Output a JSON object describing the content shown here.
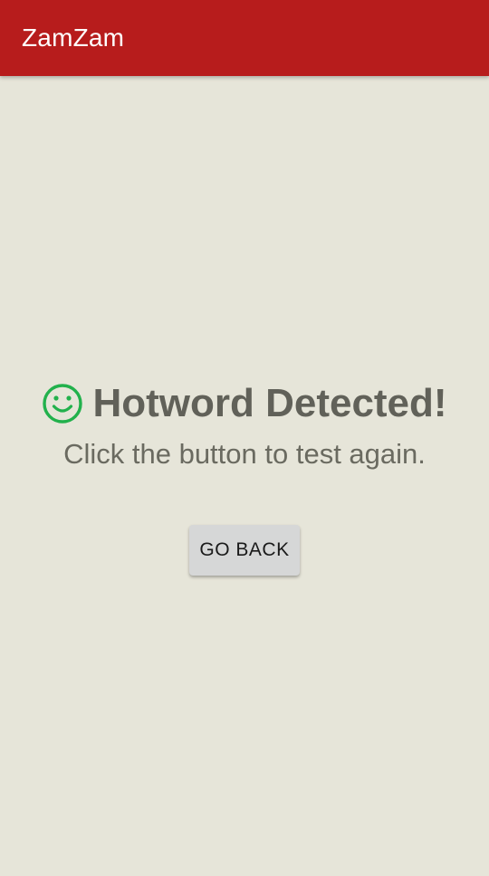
{
  "app_bar": {
    "title": "ZamZam",
    "background_color": "#b71c1c"
  },
  "status": {
    "icon": "smiley-icon",
    "icon_color": "#22b14c",
    "headline": "Hotword Detected!",
    "message": "Click the button to test again."
  },
  "actions": {
    "go_back_label": "GO BACK"
  }
}
